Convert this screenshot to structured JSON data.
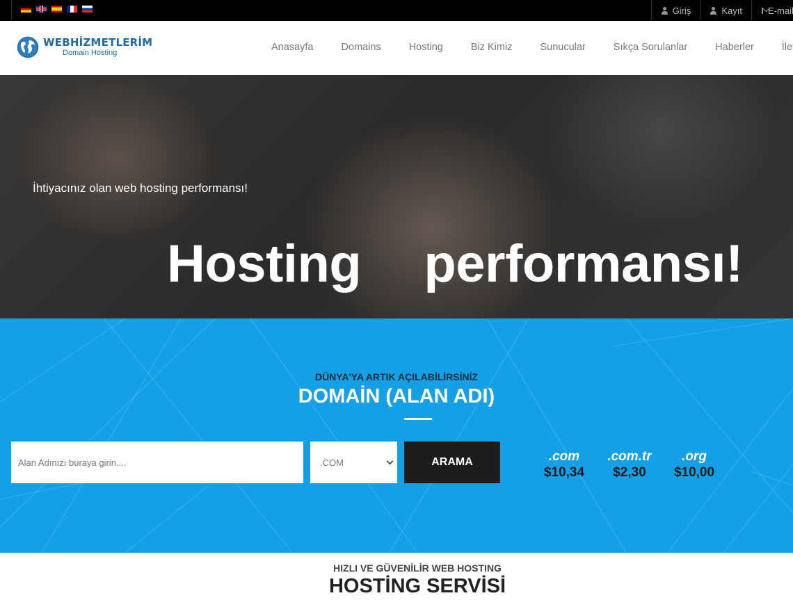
{
  "topbar": {
    "languages": [
      "de",
      "en",
      "es",
      "fr",
      "ru"
    ],
    "links": [
      {
        "label": "Giriş",
        "icon": "user-icon"
      },
      {
        "label": "Kayıt",
        "icon": "user-icon"
      },
      {
        "label": "E-mail",
        "icon": "mail-icon"
      }
    ]
  },
  "header": {
    "logo_name": "WEBHİZMETLERİM",
    "logo_sub": "Domain Hosting",
    "nav": [
      "Anasayfa",
      "Domains",
      "Hosting",
      "Biz Kimiz",
      "Sunucular",
      "Sıkça Sorulanlar",
      "Haberler",
      "İletişim"
    ]
  },
  "hero": {
    "subtitle": "İhtiyacınız olan web hosting performansı!",
    "title_left": "Hosting",
    "title_right": "performansı!"
  },
  "domain": {
    "kicker": "DÜNYA'YA ARTIK AÇILABİLİRSİNİZ",
    "title": "DOMAİN (ALAN ADI)",
    "input_placeholder": "Alan Adınızı buraya girin....",
    "tld_selected": ".COM",
    "search_label": "ARAMA",
    "prices": [
      {
        "tld": ".com",
        "price": "$10,34"
      },
      {
        "tld": ".com.tr",
        "price": "$2,30"
      },
      {
        "tld": ".org",
        "price": "$10,00"
      }
    ],
    "accent_color": "#13a0e6"
  },
  "hosting": {
    "kicker": "HIZLI VE GÜVENİLİR WEB HOSTING",
    "title": "HOSTİNG SERVİSİ"
  }
}
